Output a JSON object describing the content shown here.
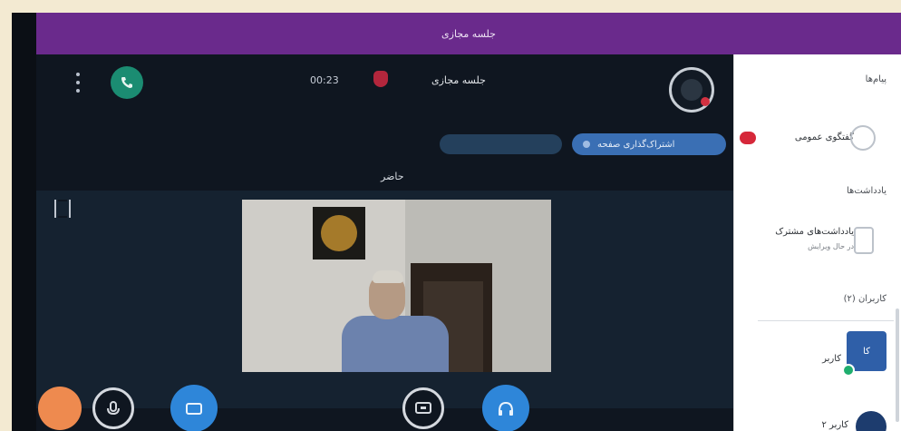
{
  "app_bar": {
    "title": "جلسه مجازی"
  },
  "meeting": {
    "timer": "00:23",
    "user_name": "جلسه مجازی",
    "tabs": [
      {
        "label": "",
        "active": false
      },
      {
        "label": "اشتراک‌گذاری صفحه",
        "active": true
      }
    ],
    "speaker_label": "حاضر"
  },
  "side_panel": {
    "section_messages": "پیام‌ها",
    "public_chat": "گفتگوی عمومی",
    "section_notes": "یادداشت‌ها",
    "shared_notes": "یادداشت‌های مشترک",
    "shared_notes_sub": "در حال ویرایش",
    "section_users": "کاربران (۲)",
    "user_1": "کاربر",
    "user_1_initials": "کا",
    "user_2": "کاربر ۲"
  },
  "colors": {
    "header_purple": "#6a2a8c",
    "accent_blue": "#2e86d9",
    "end_call_green": "#1b8c72",
    "alert_red": "#d23141",
    "orange": "#ee8a4f"
  },
  "icons": {
    "menu": "more-vertical-icon",
    "phone": "phone-icon",
    "record": "record-icon",
    "fullscreen": "fullscreen-icon",
    "mute": "microphone-icon",
    "camera": "camera-icon",
    "screen_share": "screen-share-icon",
    "audio": "headphones-icon"
  }
}
